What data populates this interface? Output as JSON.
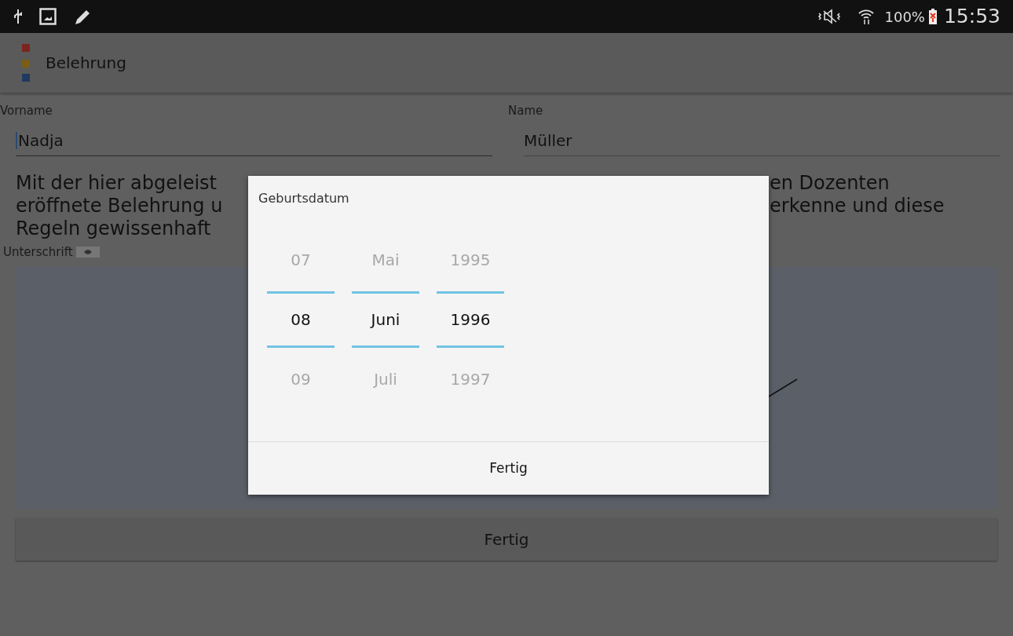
{
  "status_bar": {
    "battery": "100%",
    "time": "15:53"
  },
  "app_bar": {
    "title": "Belehrung"
  },
  "fields": [
    {
      "label": "Vorname",
      "value": "Nadja",
      "focused": true
    },
    {
      "label": "Name",
      "value": "Müller",
      "focused": false
    }
  ],
  "paragraph_lines": [
    {
      "left": "Mit der hier abgeleist",
      "right": "en Dozenten"
    },
    {
      "left": "eröffnete Belehrung u",
      "right": "erkenne und diese"
    },
    {
      "left": "Regeln gewissenhaft"
    }
  ],
  "signature": {
    "label": "Unterschrift"
  },
  "submit_button": "Fertig",
  "dialog": {
    "title": "Geburtsdatum",
    "columns": [
      {
        "items": [
          {
            "text": "07",
            "selected": false
          },
          {
            "text": "08",
            "selected": true
          },
          {
            "text": "09",
            "selected": false
          }
        ]
      },
      {
        "items": [
          {
            "text": "Mai",
            "selected": false
          },
          {
            "text": "Juni",
            "selected": true
          },
          {
            "text": "Juli",
            "selected": false
          }
        ]
      },
      {
        "items": [
          {
            "text": "1995",
            "selected": false
          },
          {
            "text": "1996",
            "selected": true
          },
          {
            "text": "1997",
            "selected": false
          }
        ]
      }
    ],
    "button": "Fertig"
  }
}
